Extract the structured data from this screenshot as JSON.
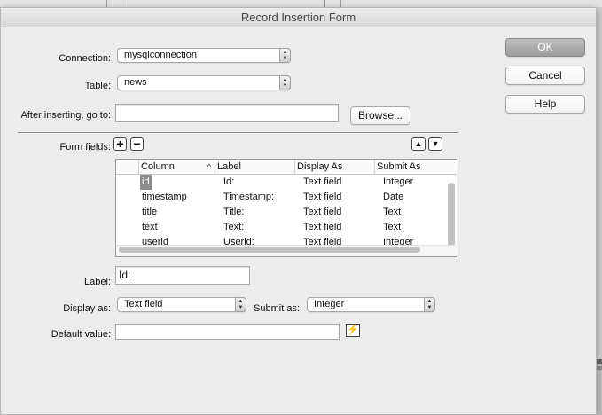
{
  "dialog": {
    "title": "Record Insertion Form"
  },
  "connection": {
    "label": "Connection:",
    "value": "mysqlconnection"
  },
  "table": {
    "label": "Table:",
    "value": "news"
  },
  "after_insert": {
    "label": "After inserting, go to:",
    "value": "",
    "browse_label": "Browse..."
  },
  "buttons": {
    "ok": "OK",
    "cancel": "Cancel",
    "help": "Help"
  },
  "form_fields": {
    "label": "Form fields:",
    "add_icon": "plus-icon",
    "remove_icon": "minus-icon",
    "move_up_icon": "triangle-up-icon",
    "move_down_icon": "triangle-down-icon",
    "columns": [
      "Column",
      "Label",
      "Display As",
      "Submit As"
    ],
    "rows": [
      {
        "column": "id",
        "label": "Id:",
        "display_as": "Text field",
        "submit_as": "Integer"
      },
      {
        "column": "timestamp",
        "label": "Timestamp:",
        "display_as": "Text field",
        "submit_as": "Date"
      },
      {
        "column": "title",
        "label": "Title:",
        "display_as": "Text field",
        "submit_as": "Text"
      },
      {
        "column": "text",
        "label": "Text:",
        "display_as": "Text field",
        "submit_as": "Text"
      },
      {
        "column": "userid",
        "label": "Userid:",
        "display_as": "Text field",
        "submit_as": "Integer"
      }
    ]
  },
  "field_label": {
    "label": "Label:",
    "value": "Id:"
  },
  "display_as": {
    "label": "Display as:",
    "value": "Text field"
  },
  "submit_as": {
    "label": "Submit as:",
    "value": "Integer"
  },
  "default_value": {
    "label": "Default value:",
    "value": "",
    "icon": "dynamic-data-icon"
  },
  "colors": {
    "default_button": "#a6a6a6",
    "selection": "#8a8a8a"
  }
}
